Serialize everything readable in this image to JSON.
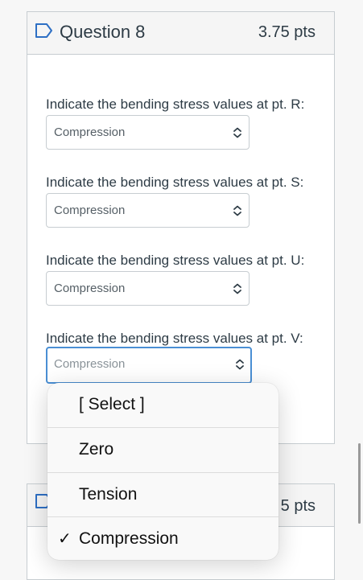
{
  "question": {
    "title": "Question 8",
    "points": "3.75 pts",
    "prompts": [
      {
        "text": "Indicate the bending stress values at pt. R:",
        "selected": "Compression"
      },
      {
        "text": "Indicate the bending stress values at pt. S:",
        "selected": "Compression"
      },
      {
        "text": "Indicate the bending stress values at pt. U:",
        "selected": "Compression"
      },
      {
        "text": "Indicate the bending stress values at pt. V:",
        "selected": "Compression"
      }
    ]
  },
  "next_question": {
    "points": "5 pts"
  },
  "dropdown_menu": {
    "options": [
      "[ Select ]",
      "Zero",
      "Tension",
      "Compression"
    ],
    "checked": "Compression",
    "check_mark": "✓"
  },
  "colors": {
    "focus_border": "#4a8fd4",
    "text": "#2d3b45",
    "border": "#c7cdd1"
  },
  "icons": {
    "flag": "flag-icon",
    "select_arrows": "up-down-chevron-icon",
    "check": "checkmark-icon"
  }
}
